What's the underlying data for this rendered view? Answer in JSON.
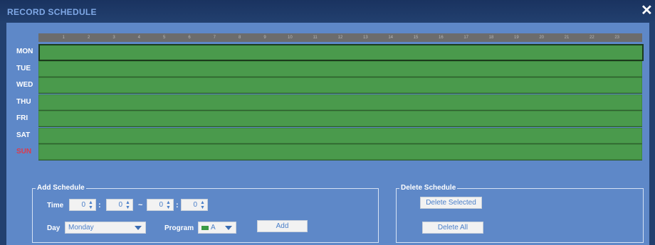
{
  "window": {
    "title": "RECORD SCHEDULE",
    "close_glyph": "✕"
  },
  "hours": [
    "1",
    "2",
    "3",
    "4",
    "5",
    "6",
    "7",
    "8",
    "9",
    "10",
    "11",
    "12",
    "13",
    "14",
    "15",
    "16",
    "17",
    "18",
    "19",
    "20",
    "21",
    "22",
    "23"
  ],
  "days": [
    "MON",
    "TUE",
    "WED",
    "THU",
    "FRI",
    "SAT",
    "SUN"
  ],
  "selected_day": "MON",
  "schedule_color": "#4a9a4c",
  "add_schedule": {
    "legend": "Add Schedule",
    "time_label": "Time",
    "start_hour": "0",
    "start_minute": "0",
    "range_separator": "~",
    "time_separator": ":",
    "end_hour": "0",
    "end_minute": "0",
    "day_label": "Day",
    "day_value": "Monday",
    "program_label": "Program",
    "program_value": "A",
    "program_color": "#3a9a45",
    "add_button": "Add"
  },
  "delete_schedule": {
    "legend": "Delete Schedule",
    "delete_selected_button": "Delete Selected",
    "delete_all_button": "Delete All"
  }
}
